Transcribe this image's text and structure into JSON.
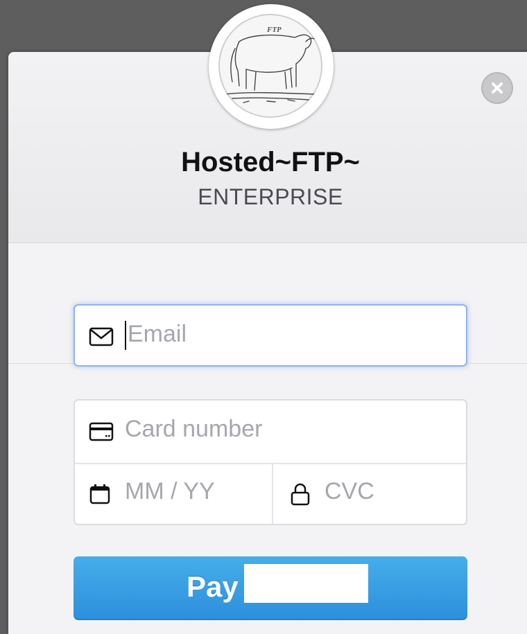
{
  "store": {
    "name": "Hosted~FTP~",
    "plan": "ENTERPRISE",
    "logo_text": "FTP"
  },
  "form": {
    "email_placeholder": "Email",
    "card_number_placeholder": "Card number",
    "expiry_placeholder": "MM / YY",
    "cvc_placeholder": "CVC"
  },
  "pay_button": {
    "label": "Pay"
  },
  "icons": {
    "close": "close-icon",
    "email": "envelope-icon",
    "card": "credit-card-icon",
    "expiry": "calendar-icon",
    "cvc": "lock-icon"
  },
  "colors": {
    "backdrop": "#5e5e5e",
    "accent": "#2d8fdc",
    "focus": "#8fb3ee"
  }
}
